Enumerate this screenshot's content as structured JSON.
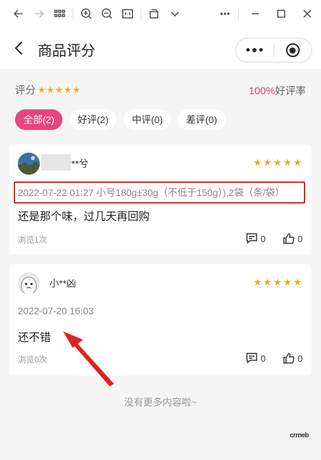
{
  "toolbar": {
    "icons": [
      "back-arrow-icon",
      "forward-arrow-icon",
      "grid-icon",
      "zoom-in-icon",
      "zoom-out-icon",
      "fit-icon",
      "rotate-icon",
      "chevron-down-icon",
      "more-icon",
      "minimize-icon",
      "maximize-icon",
      "close-icon"
    ]
  },
  "navbar": {
    "title": "商品评分"
  },
  "summary": {
    "label": "评分",
    "rate_value": "100%",
    "rate_label": "好评率"
  },
  "filters": [
    {
      "label": "全部(2)",
      "active": true
    },
    {
      "label": "好评(2)",
      "active": false
    },
    {
      "label": "中评(0)",
      "active": false
    },
    {
      "label": "差评(0)",
      "active": false
    }
  ],
  "reviews": [
    {
      "user": "**兮",
      "stars": 5,
      "meta": "2022-07-22 01:27 小号180g±30g（不低于150g）),2袋（条/袋）",
      "text": "还是那个味，过几天再回购",
      "views": "浏览1次",
      "comments": "0",
      "likes": "0"
    },
    {
      "user": "小**凶",
      "stars": 5,
      "meta": "2022-07-20 16:03",
      "text": "还不错",
      "views": "浏览0次",
      "comments": "0",
      "likes": "0"
    }
  ],
  "footer": {
    "no_more": "没有更多内容啦~",
    "logo": "crmeb"
  },
  "colors": {
    "accent": "#e8457e",
    "star": "#f5a623",
    "highlight": "#e02020"
  }
}
